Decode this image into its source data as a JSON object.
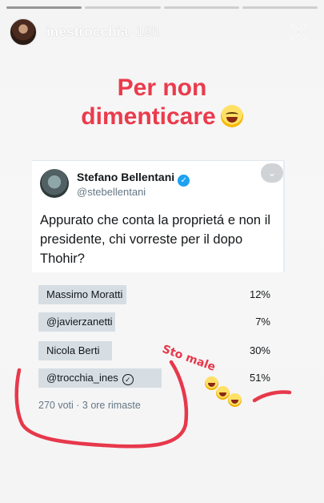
{
  "story": {
    "username": "inestrocchia",
    "time_ago": "19h",
    "progress_segments": 4,
    "progress_active_index": 0,
    "caption_line1": "Per non",
    "caption_line2": "dimenticare",
    "caption_emoji": "face-with-tears-of-joy-icon",
    "annotation_text": "Sto male",
    "annotation_emoji": "face-with-tears-of-joy-icon",
    "annotation_color": "#e7384b"
  },
  "tweet": {
    "author_name": "Stefano Bellentani",
    "author_handle": "@stebellentani",
    "verified": true,
    "text": "Appurato che conta la proprietá e non il presidente, chi vorreste per il dopo Thohir?",
    "poll": {
      "options": [
        {
          "label": "Massimo Moratti",
          "percent_label": "12%",
          "percent": 12,
          "selected": false
        },
        {
          "label": "@javierzanetti",
          "percent_label": "7%",
          "percent": 7,
          "selected": false
        },
        {
          "label": "Nicola Berti",
          "percent_label": "30%",
          "percent": 30,
          "selected": false
        },
        {
          "label": "@trocchia_ines",
          "percent_label": "51%",
          "percent": 51,
          "selected": true
        }
      ],
      "meta": "270 voti · 3 ore rimaste"
    }
  },
  "colors": {
    "caption": "#ea3b4c",
    "poll_bar": "#d6dee4",
    "twitter_blue": "#1da1f2",
    "secondary_text": "#657786"
  }
}
